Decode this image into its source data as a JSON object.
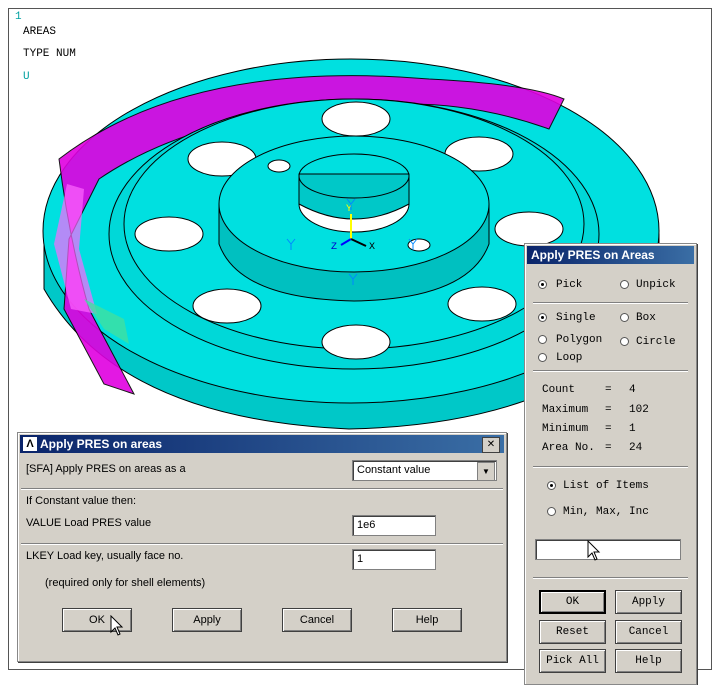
{
  "graphics": {
    "window_number": "1",
    "mode_label": "AREAS",
    "type_label": "TYPE NUM",
    "u_label": "U",
    "axis_y": "Y",
    "axis_z": "Z",
    "axis_x": "X",
    "model_color": "#00e5e5",
    "selected_color": "#e000e0"
  },
  "picker": {
    "title": "Apply PRES on Areas",
    "pick_label": "Pick",
    "unpick_label": "Unpick",
    "single_label": "Single",
    "box_label": "Box",
    "polygon_label": "Polygon",
    "circle_label": "Circle",
    "loop_label": "Loop",
    "count_label": "Count",
    "count_value": "4",
    "maximum_label": "Maximum",
    "maximum_value": "102",
    "minimum_label": "Minimum",
    "minimum_value": "1",
    "area_label": "Area No.",
    "area_value": "24",
    "eq": "=",
    "list_label": "List of Items",
    "minmax_label": "Min, Max, Inc",
    "input_value": "",
    "ok": "OK",
    "apply": "Apply",
    "reset": "Reset",
    "cancel": "Cancel",
    "pick_all": "Pick All",
    "help": "Help"
  },
  "dialog": {
    "title": "Apply PRES on areas",
    "sfa_label": "[SFA] Apply PRES on areas as a",
    "sfa_value": "Constant value",
    "if_constant": "If Constant value then:",
    "value_label": "VALUE  Load PRES value",
    "value_input": "1e6",
    "lkey_label": "LKEY  Load key, usually face no.",
    "lkey_input": "1",
    "lkey_note": "(required only for shell elements)",
    "ok": "OK",
    "apply": "Apply",
    "cancel": "Cancel",
    "help": "Help",
    "close_symbol": "✕",
    "dropdown_symbol": "▼"
  }
}
